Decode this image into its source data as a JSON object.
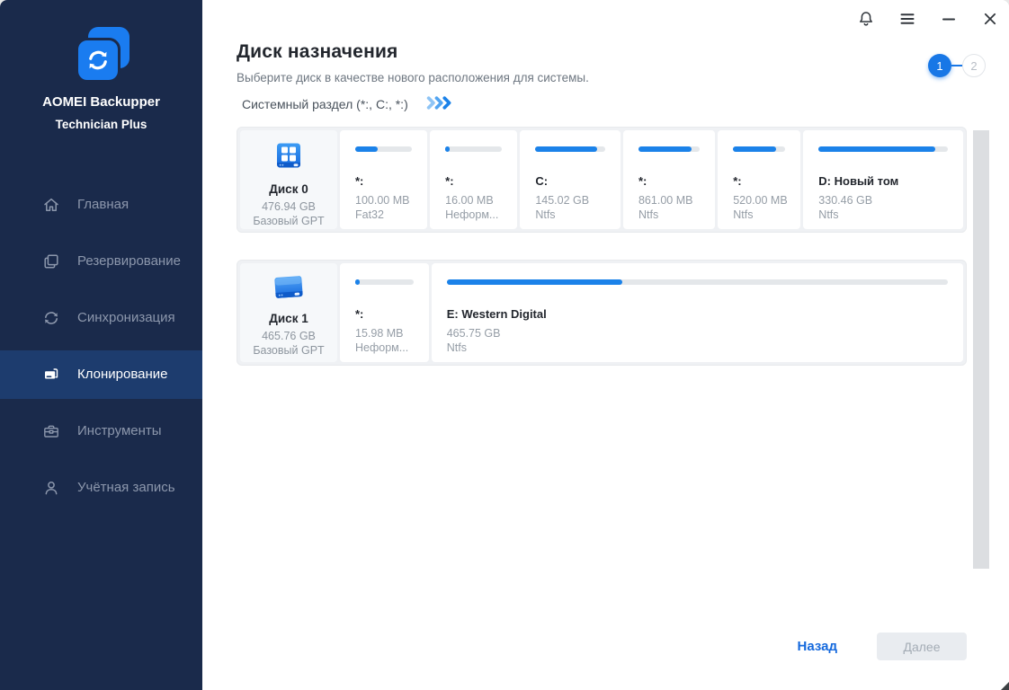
{
  "app": {
    "name": "AOMEI Backupper",
    "edition": "Technician Plus"
  },
  "titlebar": {
    "icons": [
      {
        "name": "bell-icon"
      },
      {
        "name": "menu-icon"
      },
      {
        "name": "minimize-icon"
      },
      {
        "name": "close-icon"
      }
    ]
  },
  "sidebar": {
    "items": [
      {
        "key": "home",
        "label": "Главная",
        "icon": "home-icon",
        "selected": false
      },
      {
        "key": "backup",
        "label": "Резервирование",
        "icon": "backup-icon",
        "selected": false
      },
      {
        "key": "sync",
        "label": "Синхронизация",
        "icon": "sync-icon",
        "selected": false
      },
      {
        "key": "clone",
        "label": "Клонирование",
        "icon": "clone-icon",
        "selected": true
      },
      {
        "key": "tools",
        "label": "Инструменты",
        "icon": "tools-icon",
        "selected": false
      },
      {
        "key": "account",
        "label": "Учётная запись",
        "icon": "account-icon",
        "selected": false
      }
    ]
  },
  "header": {
    "title": "Диск назначения",
    "subtitle": "Выберите диск в качестве нового расположения для системы.",
    "source_label": "Системный раздел (*:, C:, *:)",
    "steps": [
      {
        "label": "1",
        "active": true
      },
      {
        "label": "2",
        "active": false
      }
    ]
  },
  "disks": [
    {
      "name": "Диск 0",
      "size": "476.94 GB",
      "layout": "Базовый GPT",
      "icon": "ssd-disk-icon",
      "partitions": [
        {
          "label": "*:",
          "size": "100.00 MB",
          "fs": "Fat32",
          "used_pct": 40,
          "width_weight": 87
        },
        {
          "label": "*:",
          "size": "16.00 MB",
          "fs": "Неформ...",
          "used_pct": 8,
          "width_weight": 87
        },
        {
          "label": "C:",
          "size": "145.02 GB",
          "fs": "Ntfs",
          "used_pct": 88,
          "width_weight": 107
        },
        {
          "label": "*:",
          "size": "861.00 MB",
          "fs": "Ntfs",
          "used_pct": 87,
          "width_weight": 94
        },
        {
          "label": "*:",
          "size": "520.00 MB",
          "fs": "Ntfs",
          "used_pct": 83,
          "width_weight": 80
        },
        {
          "label": "D: Новый том",
          "size": "330.46 GB",
          "fs": "Ntfs",
          "used_pct": 90,
          "width_weight": 198
        }
      ]
    },
    {
      "name": "Диск 1",
      "size": "465.76 GB",
      "layout": "Базовый GPT",
      "icon": "hdd-disk-icon",
      "partitions": [
        {
          "label": "*:",
          "size": "15.98 MB",
          "fs": "Неформ...",
          "used_pct": 8,
          "width_weight": 72
        },
        {
          "label": "E: Western Digital",
          "size": "465.75 GB",
          "fs": "Ntfs",
          "used_pct": 35,
          "width_weight": 620
        }
      ]
    }
  ],
  "footer": {
    "back_label": "Назад",
    "next_label": "Далее",
    "next_enabled": false
  },
  "colors": {
    "accent": "#1877e6",
    "bar_fill": "#1b82e9",
    "sidebar_bg": "#1a2a4b",
    "sidebar_selected_bg": "#1d3c6e",
    "back_link": "#1569dd",
    "logo_blue": "#1a7cf0"
  }
}
